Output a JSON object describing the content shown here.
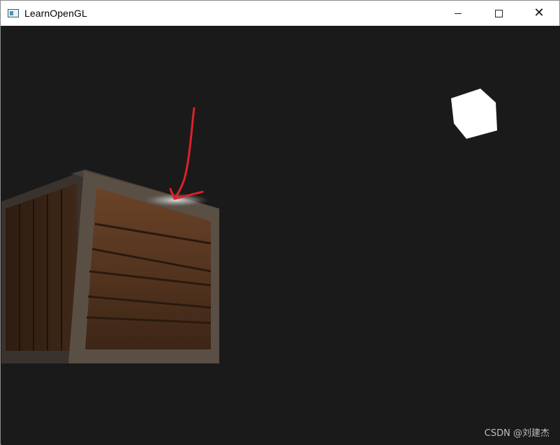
{
  "window": {
    "title": "LearnOpenGL",
    "icon": "opengl-app-icon",
    "controls": {
      "minimize": "minimize-icon",
      "maximize": "maximize-icon",
      "close": "close-icon",
      "close_glyph": "✕"
    }
  },
  "scene": {
    "background_color": "#1a1a1a",
    "objects": [
      "wooden-crate",
      "light-cube",
      "annotation-arrow"
    ],
    "colors": {
      "light_cube": "#ffffff",
      "arrow": "#e0202a",
      "crate_frame": "#5a4f44",
      "crate_wood": "#5a3a22"
    }
  },
  "watermark": "CSDN @刘建杰"
}
